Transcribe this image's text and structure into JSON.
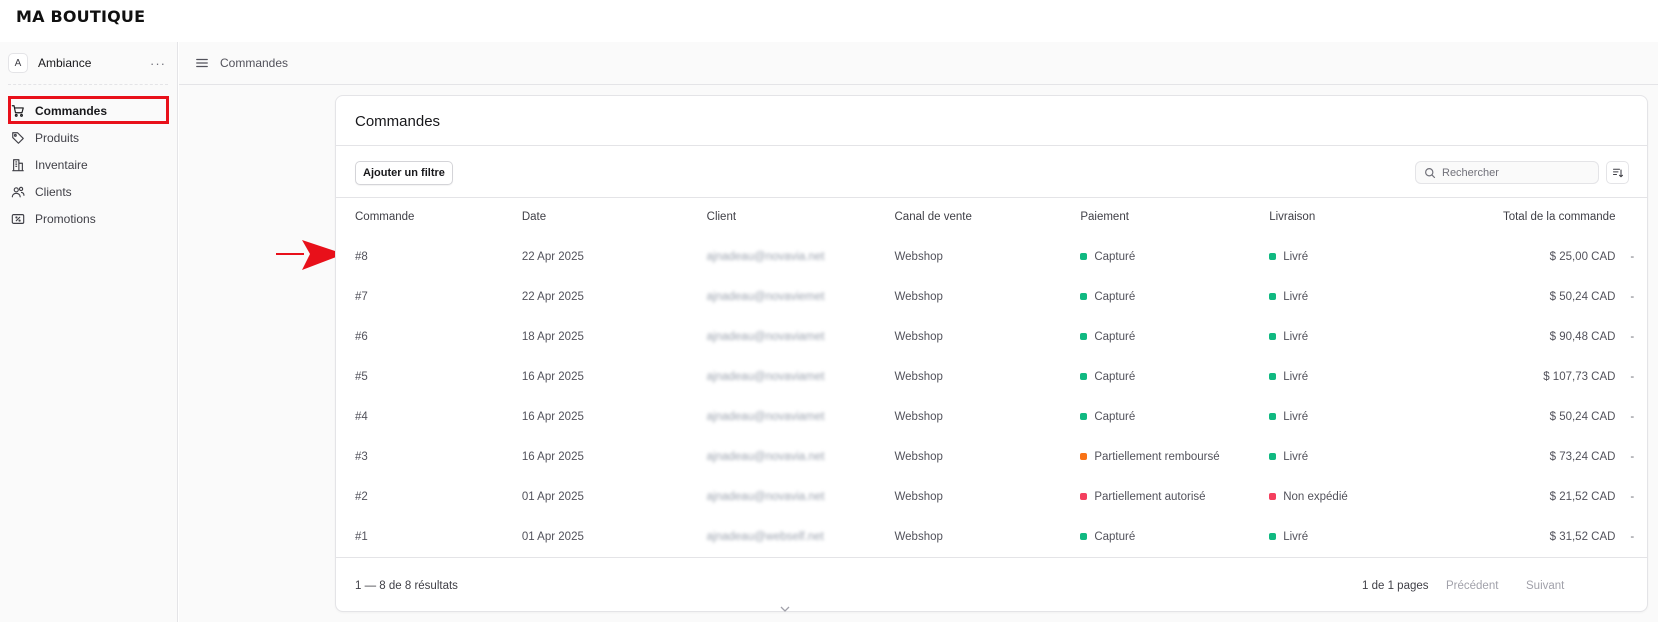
{
  "brand": "MA BOUTIQUE",
  "store": {
    "avatar": "A",
    "name": "Ambiance",
    "more": "···"
  },
  "nav": [
    {
      "label": "Commandes",
      "icon": "shopping-cart-icon",
      "active": true
    },
    {
      "label": "Produits",
      "icon": "tag-icon",
      "active": false
    },
    {
      "label": "Inventaire",
      "icon": "buildings-icon",
      "active": false
    },
    {
      "label": "Clients",
      "icon": "users-icon",
      "active": false
    },
    {
      "label": "Promotions",
      "icon": "receipt-percent-icon",
      "active": false
    }
  ],
  "breadcrumb": "Commandes",
  "orders": {
    "title": "Commandes",
    "filter_label": "Ajouter un filtre",
    "search_placeholder": "Rechercher",
    "columns": [
      "Commande",
      "Date",
      "Client",
      "Canal de vente",
      "Paiement",
      "Livraison",
      "Total de la commande"
    ],
    "rows": [
      {
        "id": "#8",
        "date": "22 Apr 2025",
        "client": "ajnadeau@novavia.net",
        "channel": "Webshop",
        "payment": "Capturé",
        "payment_color": "#10b981",
        "delivery": "Livré",
        "delivery_color": "#10b981",
        "total": "$ 25,00 CAD",
        "more": "-"
      },
      {
        "id": "#7",
        "date": "22 Apr 2025",
        "client": "ajnadeau@novaviemet",
        "channel": "Webshop",
        "payment": "Capturé",
        "payment_color": "#10b981",
        "delivery": "Livré",
        "delivery_color": "#10b981",
        "total": "$ 50,24 CAD",
        "more": "-"
      },
      {
        "id": "#6",
        "date": "18 Apr 2025",
        "client": "ajnadeau@novaviamet",
        "channel": "Webshop",
        "payment": "Capturé",
        "payment_color": "#10b981",
        "delivery": "Livré",
        "delivery_color": "#10b981",
        "total": "$ 90,48 CAD",
        "more": "-"
      },
      {
        "id": "#5",
        "date": "16 Apr 2025",
        "client": "ajnadeau@novaviamet",
        "channel": "Webshop",
        "payment": "Capturé",
        "payment_color": "#10b981",
        "delivery": "Livré",
        "delivery_color": "#10b981",
        "total": "$ 107,73 CAD",
        "more": "-"
      },
      {
        "id": "#4",
        "date": "16 Apr 2025",
        "client": "ajnadeau@novaviamet",
        "channel": "Webshop",
        "payment": "Capturé",
        "payment_color": "#10b981",
        "delivery": "Livré",
        "delivery_color": "#10b981",
        "total": "$ 50,24 CAD",
        "more": "-"
      },
      {
        "id": "#3",
        "date": "16 Apr 2025",
        "client": "ajnadeau@novavia.net",
        "channel": "Webshop",
        "payment": "Partiellement remboursé",
        "payment_color": "#f97316",
        "delivery": "Livré",
        "delivery_color": "#10b981",
        "total": "$ 73,24 CAD",
        "more": "-"
      },
      {
        "id": "#2",
        "date": "01 Apr 2025",
        "client": "ajnadeau@novavia.net",
        "channel": "Webshop",
        "payment": "Partiellement autorisé",
        "payment_color": "#f43f5e",
        "delivery": "Non expédié",
        "delivery_color": "#f43f5e",
        "total": "$ 21,52 CAD",
        "more": "-"
      },
      {
        "id": "#1",
        "date": "01 Apr 2025",
        "client": "ajnadeau@webself.net",
        "channel": "Webshop",
        "payment": "Capturé",
        "payment_color": "#10b981",
        "delivery": "Livré",
        "delivery_color": "#10b981",
        "total": "$ 31,52 CAD",
        "more": "-"
      }
    ],
    "footer": {
      "count": "1 — 8 de 8 résultats",
      "pages": "1 de 1 pages",
      "prev": "Précédent",
      "next": "Suivant"
    }
  },
  "colors": {
    "highlight": "#e8101a",
    "arrow": "#e8101a",
    "success": "#10b981",
    "warning": "#f97316",
    "danger": "#f43f5e"
  }
}
